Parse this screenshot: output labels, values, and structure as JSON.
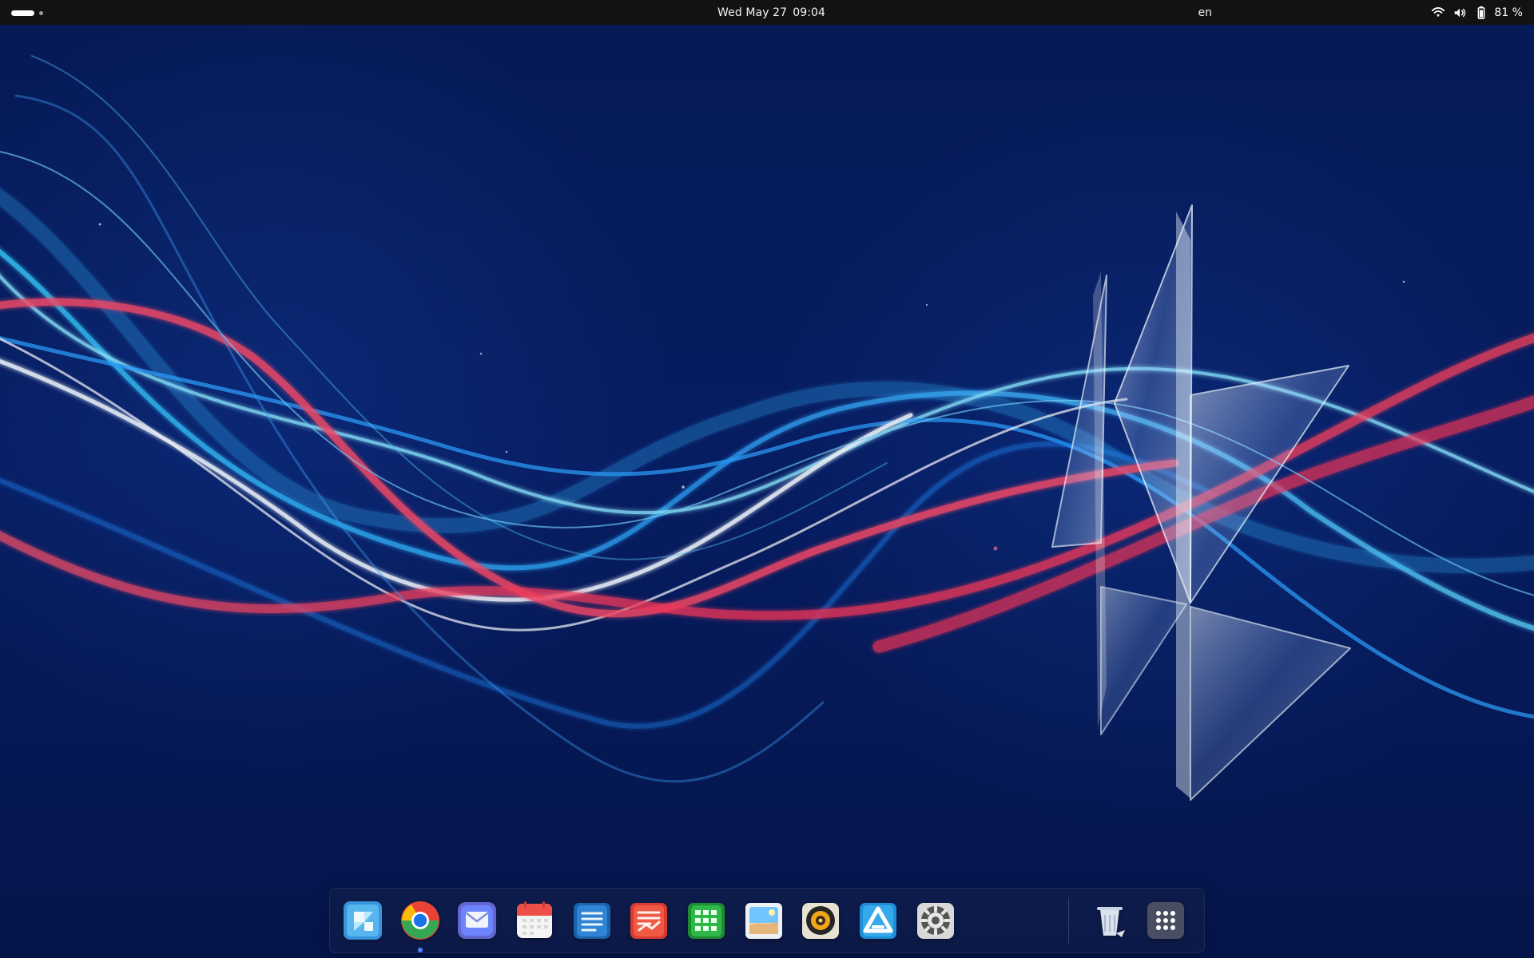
{
  "topbar": {
    "date": "Wed May 27",
    "time": "09:04",
    "language": "en",
    "battery_percent": "81 %",
    "status_icons": [
      "wifi-icon",
      "volume-icon",
      "battery-icon"
    ]
  },
  "wallpaper": {
    "colors": {
      "background": "#061a56",
      "blue_ribbon": "#32b7ff",
      "red_ribbon": "#ff405f",
      "white_highlight": "#ffffff",
      "crystal": "#dbe9ff"
    }
  },
  "dock": {
    "items": [
      {
        "name": "App Center",
        "icon": "app-center-icon"
      },
      {
        "name": "Google Chrome",
        "icon": "chrome-icon",
        "running": true
      },
      {
        "name": "Mail",
        "icon": "mail-icon"
      },
      {
        "name": "Calendar",
        "icon": "calendar-icon"
      },
      {
        "name": "Text Editor",
        "icon": "text-editor-icon"
      },
      {
        "name": "Presentation",
        "icon": "presentation-icon"
      },
      {
        "name": "Spreadsheet",
        "icon": "spreadsheet-icon"
      },
      {
        "name": "Image Viewer",
        "icon": "image-viewer-icon"
      },
      {
        "name": "Music",
        "icon": "music-icon"
      },
      {
        "name": "Affinity",
        "icon": "affinity-icon"
      },
      {
        "name": "Settings",
        "icon": "settings-icon"
      },
      {
        "name": "Trash",
        "icon": "trash-icon"
      },
      {
        "name": "Show Apps",
        "icon": "apps-grid-icon"
      }
    ]
  }
}
